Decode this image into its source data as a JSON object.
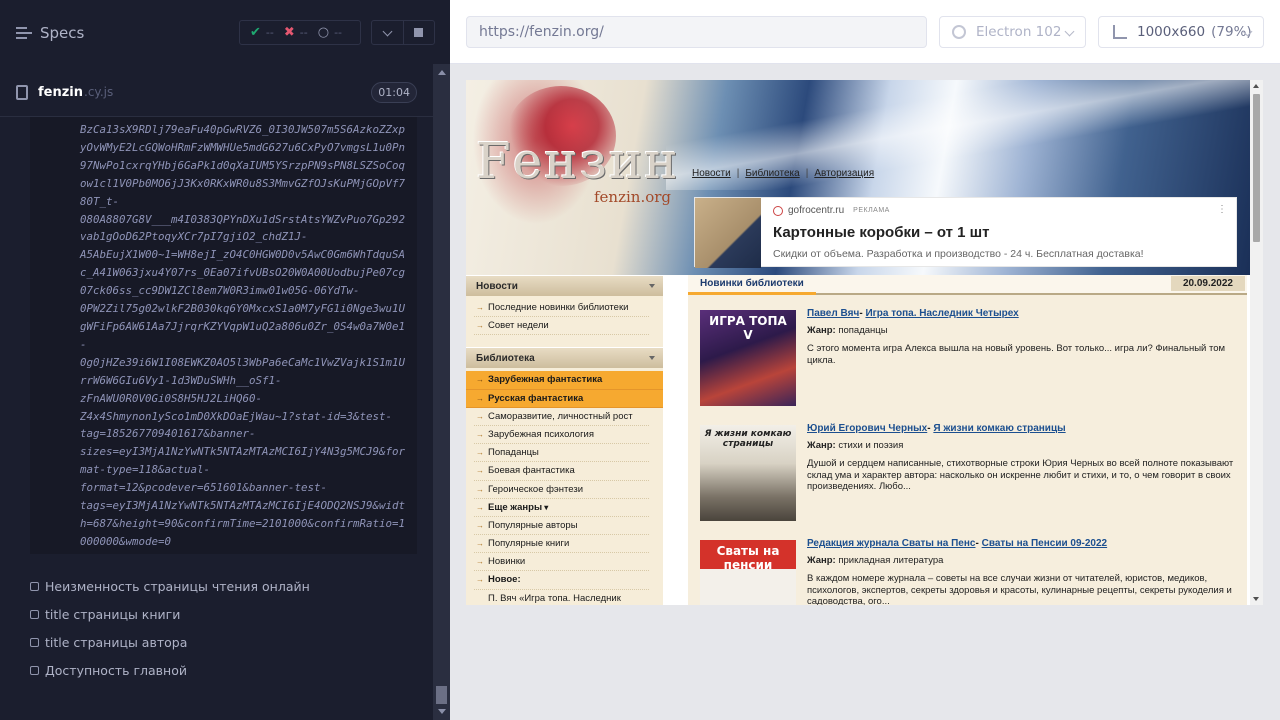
{
  "runner": {
    "specs_label": "Specs",
    "stats": {
      "passed": "--",
      "failed": "--",
      "pending": "--"
    },
    "spec": {
      "name": "fenzin",
      "ext": ".cy.js",
      "duration": "01:04"
    },
    "log_lines": [
      "BzCa13sX9RDlj79eaFu40pGwRVZ6_0I30JW507m5S6AzkoZZxp",
      "yOvWMyE2LcGQWoHRmFzWMWHUe5mdG627u6CxPyO7vmgsL1u0Pn",
      "97NwPo1cxrqYHbj6GaPk1d0qXaIUM5YSrzpPN9sPN8LSZSoCoq",
      "ow1cl1V0Pb0MO6jJ3Kx0RKxWR0u8S3MmvGZfOJsKuPMjGOpVf7",
      "80T_t-",
      "080A8807G8V___m4I0383QPYnDXu1dSrstAtsYWZvPuo7Gp292",
      "vab1gOoD62PtoqyXCr7pI7gjiO2_chdZ1J-",
      "A5AbEujX1W00~1=WH8ejI_zO4C0HGW0D0v5AwC0Gm6WhTdquSA",
      "c_A41W063jxu4Y07rs_0Ea07ifvUBsO20W0A00UodbujPe07cg",
      "07ck06ss_cc9DW1ZCl8em7W0R3imw01w05G-06YdTw-",
      "0PW2Zil75g02wlkF2B030kq6Y0MxcxS1a0M7yFG1i0Nge3wu1U",
      "gWFiFp6AW61Aa7JjrqrKZYVqpW1uQ2a806u0Zr_0S4w0a7W0e1",
      "-",
      "0g0jHZe39i6W1I08EWKZ0AO5l3WbPa6eCaMc1VwZVajk1S1m1U",
      "rrW6W6GIu6Vy1-1d3WDuSWHh__oSf1-",
      "zFnAWU0R0V0Gi0S8H5HJ2LiHQ60-",
      "Z4x4Shmynon1ySco1mD0XkDOaEjWau~1?stat-id=3&test-",
      "tag=185267709401617&banner-",
      "sizes=eyI3MjA1NzYwNTk5NTAzMTAzMCI6IjY4N3g5MCJ9&for",
      "mat-type=118&actual-",
      "format=12&pcodever=651601&banner-test-",
      "tags=eyI3MjA1NzYwNTk5NTAzMTAzMCI6IjE4ODQ2NSJ9&widt",
      "h=687&height=90&confirmTime=2101000&confirmRatio=1",
      "000000&wmode=0"
    ],
    "tests": [
      "Неизменность страницы чтения онлайн",
      "title страницы книги",
      "title страницы автора",
      "Доступность главной"
    ]
  },
  "aut": {
    "url": "https://fenzin.org/",
    "browser": "Electron 102",
    "viewport": "1000x660",
    "zoom": "(79%)"
  },
  "site": {
    "logo": "Fензин",
    "logo_site": "fenzin.org",
    "topnav": [
      "Новости",
      "Библиотека",
      "Авторизация"
    ],
    "ad": {
      "domain": "gofrocentr.ru",
      "ad_label": "РЕКЛАМА",
      "title": "Картонные коробки – от 1 шт",
      "desc": "Скидки от объема. Разработка и производство - 24 ч. Бесплатная доставка!"
    },
    "news_head": "Новости",
    "news_items": [
      "Последние новинки библиотеки",
      "Совет недели"
    ],
    "lib_head": "Библиотека",
    "lib_items": [
      "Зарубежная фантастика",
      "Русская фантастика",
      "Саморазвитие, личностный рост",
      "Зарубежная психология",
      "Попаданцы",
      "Боевая фантастика",
      "Героическое фэнтези",
      "Еще жанры",
      "Популярные авторы",
      "Популярные книги",
      "Новинки",
      "Новое:",
      "П. Вяч «Игра топа. Наследник"
    ],
    "tab": "Новинки библиотеки",
    "date": "20.09.2022",
    "genre_label": "Жанр:",
    "books": [
      {
        "author": "Павел Вяч",
        "title": "Игра топа. Наследник Четырех",
        "genre": "попаданцы",
        "desc": "С этого момента игра Алекса вышла на новый уровень. Вот только... игра ли? Финальный том цикла.",
        "cover": "ИГРА ТОПА V"
      },
      {
        "author": "Юрий Егорович Черных",
        "title": "Я жизни комкаю страницы",
        "genre": "стихи и поэзия",
        "desc": "Душой и сердцем написанные, стихотворные строки Юрия Черных во всей полноте показывают склад ума и характер автора: насколько он искренне любит и стихи, и то, о чем говорит в своих произведениях. Любо...",
        "cover": "Я жизни комкаю страницы"
      },
      {
        "author": "Редакция журнала Сваты на Пенс",
        "title": "Сваты на Пенсии 09-2022",
        "genre": "прикладная литература",
        "desc": "В каждом номере журнала – советы на все случаи жизни от читателей, юристов, медиков, психологов, экспертов, секреты здоровья и красоты, кулинарные рецепты, секреты рукоделия и садоводства, ого...",
        "cover": "Сваты на пенсии"
      }
    ]
  }
}
